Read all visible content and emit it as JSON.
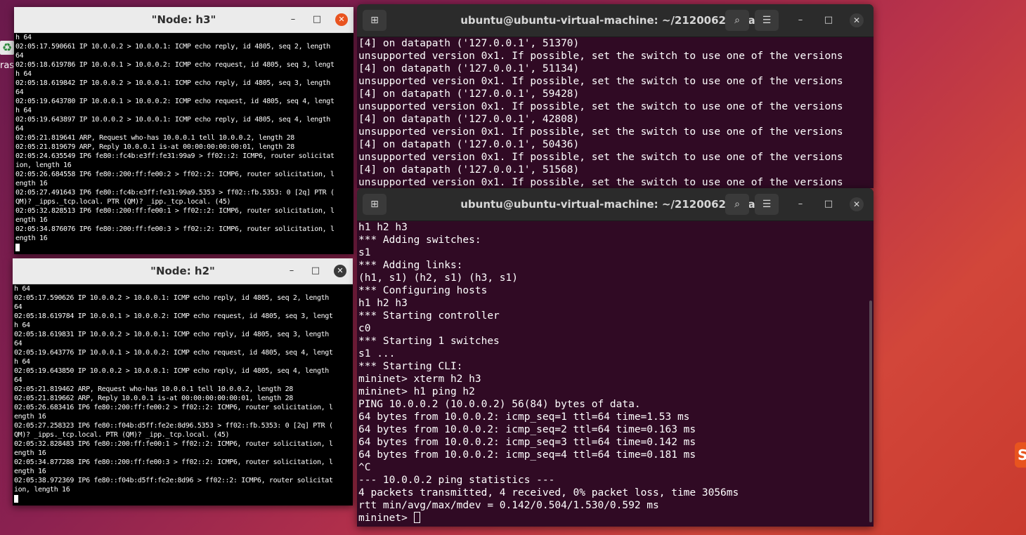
{
  "desktop": {
    "trash_label": "ras",
    "trash_icon": "recycle-icon"
  },
  "xterm_h3": {
    "title": "\"Node: h3\"",
    "lines": [
      "h 64",
      "02:05:17.590661 IP 10.0.0.2 > 10.0.0.1: ICMP echo reply, id 4805, seq 2, length",
      "64",
      "02:05:18.619786 IP 10.0.0.1 > 10.0.0.2: ICMP echo request, id 4805, seq 3, lengt",
      "h 64",
      "02:05:18.619842 IP 10.0.0.2 > 10.0.0.1: ICMP echo reply, id 4805, seq 3, length",
      "64",
      "02:05:19.643780 IP 10.0.0.1 > 10.0.0.2: ICMP echo request, id 4805, seq 4, lengt",
      "h 64",
      "02:05:19.643897 IP 10.0.0.2 > 10.0.0.1: ICMP echo reply, id 4805, seq 4, length",
      "64",
      "02:05:21.819641 ARP, Request who-has 10.0.0.1 tell 10.0.0.2, length 28",
      "02:05:21.819679 ARP, Reply 10.0.0.1 is-at 00:00:00:00:00:01, length 28",
      "02:05:24.635549 IP6 fe80::fc4b:e3ff:fe31:99a9 > ff02::2: ICMP6, router solicitat",
      "ion, length 16",
      "02:05:26.684558 IP6 fe80::200:ff:fe00:2 > ff02::2: ICMP6, router solicitation, l",
      "ength 16",
      "02:05:27.491643 IP6 fe80::fc4b:e3ff:fe31:99a9.5353 > ff02::fb.5353: 0 [2q] PTR (",
      "QM)? _ipps._tcp.local. PTR (QM)? _ipp._tcp.local. (45)",
      "02:05:32.828513 IP6 fe80::200:ff:fe00:1 > ff02::2: ICMP6, router solicitation, l",
      "ength 16",
      "02:05:34.876076 IP6 fe80::200:ff:fe00:3 > ff02::2: ICMP6, router solicitation, l",
      "ength 16"
    ]
  },
  "xterm_h2": {
    "title": "\"Node: h2\"",
    "lines": [
      "h 64",
      "02:05:17.590626 IP 10.0.0.2 > 10.0.0.1: ICMP echo reply, id 4805, seq 2, length",
      "64",
      "02:05:18.619784 IP 10.0.0.1 > 10.0.0.2: ICMP echo request, id 4805, seq 3, lengt",
      "h 64",
      "02:05:18.619831 IP 10.0.0.2 > 10.0.0.1: ICMP echo reply, id 4805, seq 3, length",
      "64",
      "02:05:19.643776 IP 10.0.0.1 > 10.0.0.2: ICMP echo request, id 4805, seq 4, lengt",
      "h 64",
      "02:05:19.643850 IP 10.0.0.2 > 10.0.0.1: ICMP echo reply, id 4805, seq 4, length",
      "64",
      "02:05:21.819462 ARP, Request who-has 10.0.0.1 tell 10.0.0.2, length 28",
      "02:05:21.819662 ARP, Reply 10.0.0.1 is-at 00:00:00:00:00:01, length 28",
      "02:05:26.683416 IP6 fe80::200:ff:fe00:2 > ff02::2: ICMP6, router solicitation, l",
      "ength 16",
      "02:05:27.258323 IP6 fe80::f04b:d5ff:fe2e:8d96.5353 > ff02::fb.5353: 0 [2q] PTR (",
      "QM)? _ipps._tcp.local. PTR (QM)? _ipp._tcp.local. (45)",
      "02:05:32.828483 IP6 fe80::200:ff:fe00:1 > ff02::2: ICMP6, router solicitation, l",
      "ength 16",
      "02:05:34.877288 IP6 fe80::200:ff:fe00:3 > ff02::2: ICMP6, router solicitation, l",
      "ength 16",
      "02:05:38.972369 IP6 fe80::f04b:d5ff:fe2e:8d96 > ff02::2: ICMP6, router solicitat",
      "ion, length 16"
    ]
  },
  "term_controller": {
    "title": "ubuntu@ubuntu-virtual-machine: ~/212006216/lab6",
    "lines": [
      "[4] on datapath ('127.0.0.1', 51370)",
      "unsupported version 0x1. If possible, set the switch to use one of the versions",
      "[4] on datapath ('127.0.0.1', 51134)",
      "unsupported version 0x1. If possible, set the switch to use one of the versions",
      "[4] on datapath ('127.0.0.1', 59428)",
      "unsupported version 0x1. If possible, set the switch to use one of the versions",
      "[4] on datapath ('127.0.0.1', 42808)",
      "unsupported version 0x1. If possible, set the switch to use one of the versions",
      "[4] on datapath ('127.0.0.1', 50436)",
      "unsupported version 0x1. If possible, set the switch to use one of the versions",
      "[4] on datapath ('127.0.0.1', 51568)",
      "unsupported version 0x1. If possible, set the switch to use one of the versions"
    ]
  },
  "term_mininet": {
    "title": "ubuntu@ubuntu-virtual-machine: ~/212006216/lab6",
    "lines": [
      "h1 h2 h3",
      "*** Adding switches:",
      "s1",
      "*** Adding links:",
      "(h1, s1) (h2, s1) (h3, s1)",
      "*** Configuring hosts",
      "h1 h2 h3",
      "*** Starting controller",
      "c0",
      "*** Starting 1 switches",
      "s1 ...",
      "*** Starting CLI:",
      "mininet> xterm h2 h3",
      "mininet> h1 ping h2",
      "PING 10.0.0.2 (10.0.0.2) 56(84) bytes of data.",
      "64 bytes from 10.0.0.2: icmp_seq=1 ttl=64 time=1.53 ms",
      "64 bytes from 10.0.0.2: icmp_seq=2 ttl=64 time=0.163 ms",
      "64 bytes from 10.0.0.2: icmp_seq=3 ttl=64 time=0.142 ms",
      "64 bytes from 10.0.0.2: icmp_seq=4 ttl=64 time=0.181 ms",
      "^C",
      "--- 10.0.0.2 ping statistics ---",
      "4 packets transmitted, 4 received, 0% packet loss, time 3056ms",
      "rtt min/avg/max/mdev = 0.142/0.504/1.530/0.592 ms"
    ],
    "prompt": "mininet> "
  },
  "icons": {
    "new_tab": "new-tab-icon",
    "search": "search-icon",
    "menu": "hamburger-menu-icon",
    "minimize": "minimize-icon",
    "maximize": "maximize-icon",
    "close": "close-icon"
  },
  "colors": {
    "xterm_close": "#e95420",
    "xterm_h2_close": "#3a3a3a",
    "terminal_bg": "#300a24"
  }
}
